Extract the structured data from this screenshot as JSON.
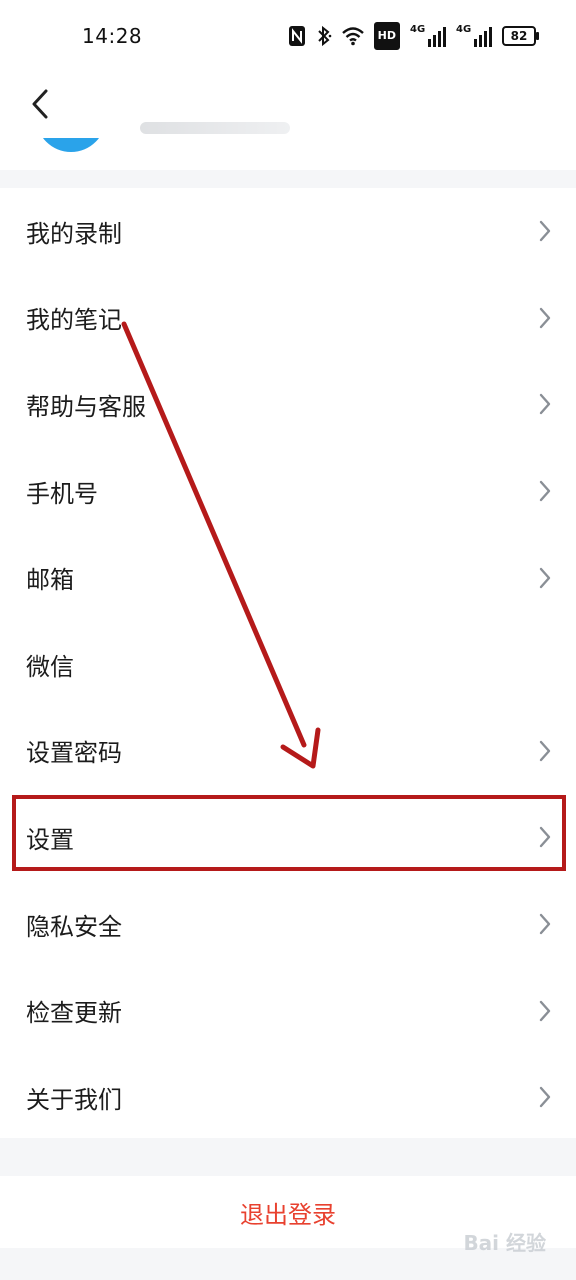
{
  "status_bar": {
    "time": "14:28",
    "icons": [
      "nfc-icon",
      "bluetooth-icon",
      "wifi-icon",
      "hd-icon",
      "4g-signal-icon",
      "4g-signal-icon",
      "battery-icon"
    ],
    "hd_label": "HD",
    "network_label_1": "4G",
    "network_label_2": "4G",
    "battery_level": "82"
  },
  "header": {
    "back_icon": "chevron-left-icon"
  },
  "menu": {
    "items": [
      {
        "label": "我的录制",
        "has_chevron": true
      },
      {
        "label": "我的笔记",
        "has_chevron": true
      },
      {
        "label": "帮助与客服",
        "has_chevron": true
      },
      {
        "label": "手机号",
        "has_chevron": true
      },
      {
        "label": "邮箱",
        "has_chevron": true
      },
      {
        "label": "微信",
        "has_chevron": false
      },
      {
        "label": "设置密码",
        "has_chevron": true
      },
      {
        "label": "设置",
        "has_chevron": true
      },
      {
        "label": "隐私安全",
        "has_chevron": true
      },
      {
        "label": "检查更新",
        "has_chevron": true
      },
      {
        "label": "关于我们",
        "has_chevron": true
      }
    ]
  },
  "logout": {
    "label": "退出登录"
  },
  "annotation": {
    "highlight_color": "#b51a1a",
    "highlighted_item": "设置"
  },
  "watermark": {
    "text": "Bai 经验"
  },
  "colors": {
    "accent_red": "#e8412f",
    "avatar_blue": "#2aa3ea",
    "background": "#f5f6f8"
  }
}
